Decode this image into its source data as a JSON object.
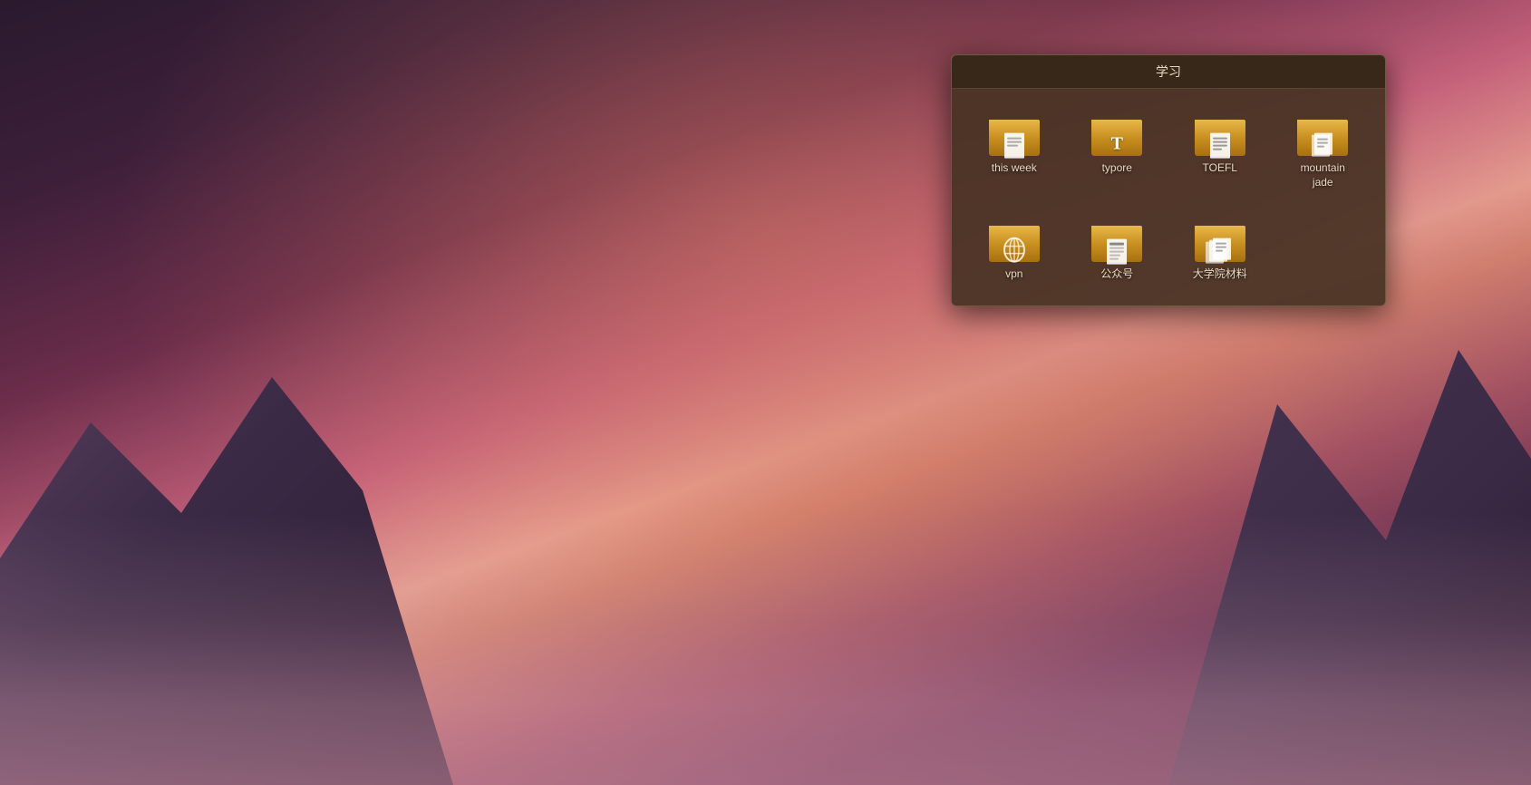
{
  "desktop": {
    "background": "japanese-pagoda-mount-fuji"
  },
  "folder_window": {
    "title": "学习",
    "items_row1": [
      {
        "id": "this-week",
        "label": "this week",
        "icon_type": "document",
        "icon_char": "📄"
      },
      {
        "id": "typore",
        "label": "typore",
        "icon_type": "typora",
        "icon_char": "T"
      },
      {
        "id": "toefl",
        "label": "TOEFL",
        "icon_type": "book",
        "icon_char": "📖"
      },
      {
        "id": "mountain-jade",
        "label": "mountain\njade",
        "icon_type": "document-stack",
        "icon_char": "📋"
      }
    ],
    "items_row2": [
      {
        "id": "vpn",
        "label": "vpn",
        "icon_type": "vpn",
        "icon_char": "🔒"
      },
      {
        "id": "gongzhonghao",
        "label": "公众号",
        "icon_type": "book",
        "icon_char": "📰"
      },
      {
        "id": "university-materials",
        "label": "大学院材料",
        "icon_type": "documents",
        "icon_char": "📚"
      }
    ]
  }
}
